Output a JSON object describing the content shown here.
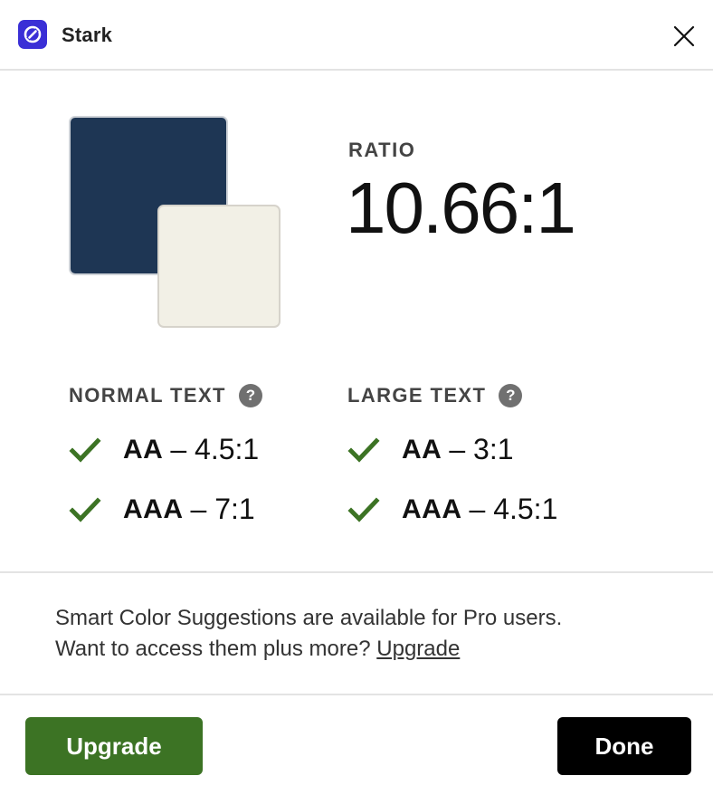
{
  "app": {
    "title": "Stark",
    "logo_icon": "stark-logo-icon",
    "accent": "#3a2fd6"
  },
  "window": {
    "close_icon": "close-icon"
  },
  "swatches": {
    "background_color": "#1e3654",
    "foreground_color": "#f2f0e6"
  },
  "ratio": {
    "label": "RATIO",
    "value": "10.66:1"
  },
  "normal_text": {
    "title": "NORMAL TEXT",
    "help_glyph": "?",
    "checks": [
      {
        "level": "AA",
        "threshold": "– 4.5:1",
        "status": "pass"
      },
      {
        "level": "AAA",
        "threshold": "– 7:1",
        "status": "pass"
      }
    ]
  },
  "large_text": {
    "title": "LARGE TEXT",
    "help_glyph": "?",
    "checks": [
      {
        "level": "AA",
        "threshold": "– 3:1",
        "status": "pass"
      },
      {
        "level": "AAA",
        "threshold": "– 4.5:1",
        "status": "pass"
      }
    ]
  },
  "promo": {
    "line1": "Smart Color Suggestions are available for Pro users.",
    "line2": "Want to access them plus more?",
    "link": "Upgrade"
  },
  "buttons": {
    "upgrade": "Upgrade",
    "done": "Done"
  },
  "colors": {
    "pass_green": "#3c7324",
    "upgrade_button": "#3c7324",
    "done_button": "#000000"
  }
}
